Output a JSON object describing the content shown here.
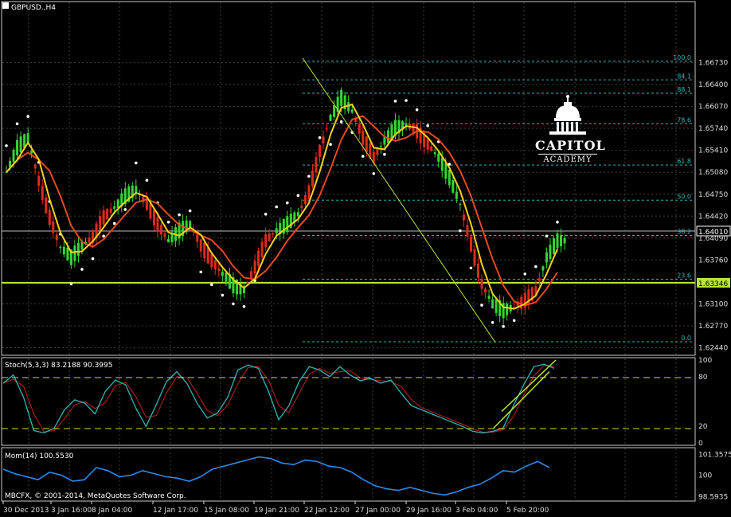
{
  "chart_data": [
    {
      "panel": "price",
      "type": "line",
      "title": "GBPUSD.,H4",
      "ylim": [
        1.6235,
        1.676
      ],
      "x_tick_labels": [
        "30 Dec 2013",
        "3 Jan 16:00",
        "8 Jan 04:00",
        "12 Jan 17:00",
        "15 Jan 08:00",
        "19 Jan 21:00",
        "22 Jan 12:00",
        "27 Jan 00:00",
        "29 Jan 16:00",
        "3 Feb 04:00",
        "5 Feb 20:00"
      ],
      "y_tick_labels": [
        "1.66730",
        "1.66400",
        "1.66070",
        "1.65740",
        "1.65410",
        "1.65080",
        "1.64750",
        "1.64420",
        "1.64090",
        "1.63760",
        "1.63430",
        "1.63100",
        "1.62770",
        "1.62440"
      ],
      "current_price": "1.64010",
      "horizontal_line": "1.63346",
      "fibonacci_levels": [
        {
          "label": "100.0",
          "price": 1.6675
        },
        {
          "label": "84.1",
          "price": 1.6647
        },
        {
          "label": "88.1",
          "price": 1.6627
        },
        {
          "label": "78.6",
          "price": 1.6581
        },
        {
          "label": "61.8",
          "price": 1.6519
        },
        {
          "label": "50.0",
          "price": 1.6466
        },
        {
          "label": "38.2",
          "price": 1.6413
        },
        {
          "label": "23.6",
          "price": 1.6347
        },
        {
          "label": "0.0",
          "price": 1.6253
        }
      ],
      "trendline": {
        "from": [
          0,
          1.668
        ],
        "to": [
          73,
          1.6252
        ]
      },
      "series": [
        {
          "kind": "close",
          "color": "#f7d11b",
          "values": [
            1.6508,
            1.6545,
            1.656,
            1.6495,
            1.644,
            1.6395,
            1.638,
            1.6398,
            1.641,
            1.644,
            1.6455,
            1.6472,
            1.6482,
            1.646,
            1.643,
            1.6405,
            1.642,
            1.643,
            1.6398,
            1.6375,
            1.6355,
            1.6338,
            1.633,
            1.6365,
            1.6405,
            1.642,
            1.643,
            1.6445,
            1.6478,
            1.654,
            1.659,
            1.662,
            1.66,
            1.656,
            1.653,
            1.6555,
            1.6575,
            1.658,
            1.657,
            1.655,
            1.653,
            1.65,
            1.646,
            1.64,
            1.634,
            1.631,
            1.63,
            1.6305,
            1.6315,
            1.633,
            1.638,
            1.6405
          ]
        },
        {
          "kind": "ma_fast",
          "color": "#f7d11b"
        },
        {
          "kind": "ma_slow",
          "color": "#e8491a"
        },
        {
          "kind": "parabolic_sar",
          "color": "#ffffff"
        }
      ]
    },
    {
      "panel": "stochastic",
      "type": "line",
      "title": "Stoch(5,3,3) 83.2188 90.3995",
      "ylim": [
        0,
        100
      ],
      "y_tick_labels": [
        "100",
        "80",
        "20",
        "0"
      ],
      "levels": [
        80,
        20
      ],
      "series": [
        {
          "name": "main",
          "color": "#2fb5b5",
          "values": [
            72,
            82,
            55,
            15,
            12,
            18,
            40,
            52,
            48,
            35,
            62,
            76,
            70,
            42,
            20,
            46,
            74,
            86,
            72,
            48,
            30,
            36,
            55,
            88,
            94,
            90,
            62,
            28,
            45,
            74,
            92,
            88,
            80,
            92,
            82,
            75,
            78,
            72,
            76,
            60,
            45,
            40,
            35,
            30,
            25,
            20,
            14,
            12,
            14,
            18,
            45,
            70,
            92,
            95,
            90
          ]
        },
        {
          "name": "signal",
          "color": "#c02020"
        }
      ]
    },
    {
      "panel": "momentum",
      "type": "line",
      "title": "Mom(14) 100.5530",
      "ylim": [
        98.4,
        101.6
      ],
      "y_tick_labels": [
        "101.3575",
        "100",
        "98.5935"
      ],
      "series": [
        {
          "name": "Mom(14)",
          "color": "#2a8bea",
          "values": [
            100.4,
            100.1,
            99.9,
            99.7,
            100.2,
            100.0,
            99.6,
            99.7,
            100.5,
            100.3,
            99.9,
            100.0,
            100.3,
            100.1,
            99.9,
            99.8,
            99.6,
            99.9,
            100.4,
            100.6,
            100.8,
            101.0,
            101.2,
            101.1,
            100.8,
            100.7,
            101.0,
            100.9,
            100.6,
            100.5,
            100.2,
            99.7,
            99.3,
            99.1,
            99.0,
            99.2,
            99.0,
            98.8,
            98.7,
            98.9,
            99.2,
            99.4,
            99.8,
            100.3,
            100.2,
            100.6,
            100.9,
            100.5
          ]
        }
      ]
    }
  ],
  "copyright": "MBCFX, © 2001-2014, MetaQuotes Software Corp.",
  "watermark": {
    "name": "CAPITOL",
    "sub": "ACADEMY"
  }
}
